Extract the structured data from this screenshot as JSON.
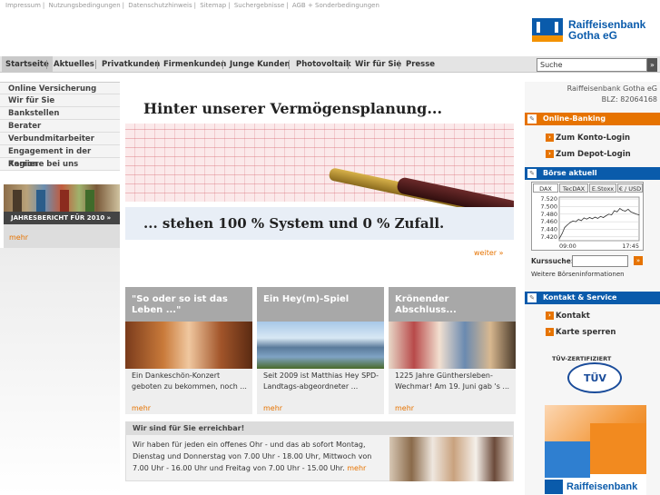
{
  "toplinks": [
    "Impressum",
    "Nutzungsbedingungen",
    "Datenschutzhinweis",
    "Sitemap",
    "Suchergebnisse",
    "AGB + Sonderbedingungen"
  ],
  "logo": {
    "line1": "Raiffeisenbank",
    "line2": "Gotha eG",
    "brand_blue": "#0a5bab",
    "brand_orange": "#f39200"
  },
  "nav": {
    "items": [
      "Startseite",
      "Aktuelles",
      "Privatkunden",
      "Firmenkunden",
      "Junge Kunden",
      "Photovoltaik",
      "Wir für Sie",
      "Presse"
    ],
    "active": "Startseite",
    "search_value": "Suche",
    "search_button": "»"
  },
  "sidebar": {
    "items": [
      "Online Versicherung",
      "Wir für Sie",
      "Bankstellen",
      "Berater",
      "Verbundmitarbeiter",
      "Engagement in der Region",
      "Karriere bei uns"
    ],
    "annual_caption": "JAHRESBERICHT FÜR 2010 »",
    "annual_more": "mehr"
  },
  "banner": {
    "headline": "Hinter unserer Vermögensplanung...",
    "subline": "... stehen 100 % System und 0 % Zufall.",
    "weiter": "weiter »"
  },
  "teasers": [
    {
      "title": "\"So oder so ist das Leben ...\"",
      "text": "Ein Dankeschön-Konzert geboten zu bekommen, noch ...",
      "more": "mehr"
    },
    {
      "title": "Ein Hey(m)-Spiel",
      "text": "Seit 2009 ist Matthias Hey SPD-Landtags-abgeordneter ...",
      "more": "mehr"
    },
    {
      "title": "Krönender Abschluss...",
      "text": "1225 Jahre Günthersleben-Wechmar! Am 19. Juni gab 's ...",
      "more": "mehr"
    }
  ],
  "reach": {
    "head": "Wir sind für Sie erreichbar!",
    "body": "Wir haben für jeden ein offenes Ohr - und das ab sofort Montag, Dienstag und Donnerstag von 7.00 Uhr - 18.00 Uhr, Mittwoch von 7.00 Uhr - 16.00 Uhr und Freitag von 7.00 Uhr - 15.00 Uhr.",
    "more": "mehr"
  },
  "right": {
    "bank_name": "Raiffeisenbank Gotha eG",
    "blz": "BLZ: 82064168",
    "online_banking": "Online-Banking",
    "konto_login": "Zum Konto-Login",
    "depot_login": "Zum Depot-Login",
    "boerse": "Börse aktuell",
    "kurssuche": "Kurssuche:",
    "kurs_button": "»",
    "weitere": "Weitere Börseninformationen",
    "kontakt_head": "Kontakt & Service",
    "kontakt": "Kontakt",
    "karte": "Karte sperren",
    "tuv_text": "TÜV-ZERTIFIZIERT",
    "tuv_seal": "TÜV",
    "ad_logo": "Raiffeisenbank"
  },
  "chart_data": {
    "type": "line",
    "tabs": [
      "DAX",
      "TecDAX",
      "E.Stoxx",
      "€ / USD"
    ],
    "active_tab": "DAX",
    "x_ticks": [
      "09:00",
      "17:45"
    ],
    "y_ticks": [
      "7.520",
      "7.500",
      "7.480",
      "7.460",
      "7.440",
      "7.420"
    ],
    "ylim": [
      7410,
      7525
    ],
    "x": [
      0,
      1,
      2,
      3,
      4,
      5,
      6,
      7,
      8,
      9,
      10,
      11,
      12,
      13,
      14,
      15,
      16,
      17,
      18,
      19,
      20,
      21,
      22,
      23,
      24,
      25,
      26,
      27,
      28,
      29
    ],
    "values": [
      7415,
      7428,
      7445,
      7452,
      7458,
      7462,
      7460,
      7466,
      7463,
      7470,
      7467,
      7471,
      7468,
      7472,
      7469,
      7474,
      7471,
      7476,
      7480,
      7478,
      7489,
      7486,
      7495,
      7490,
      7488,
      7493,
      7486,
      7483,
      7480,
      7478
    ]
  }
}
